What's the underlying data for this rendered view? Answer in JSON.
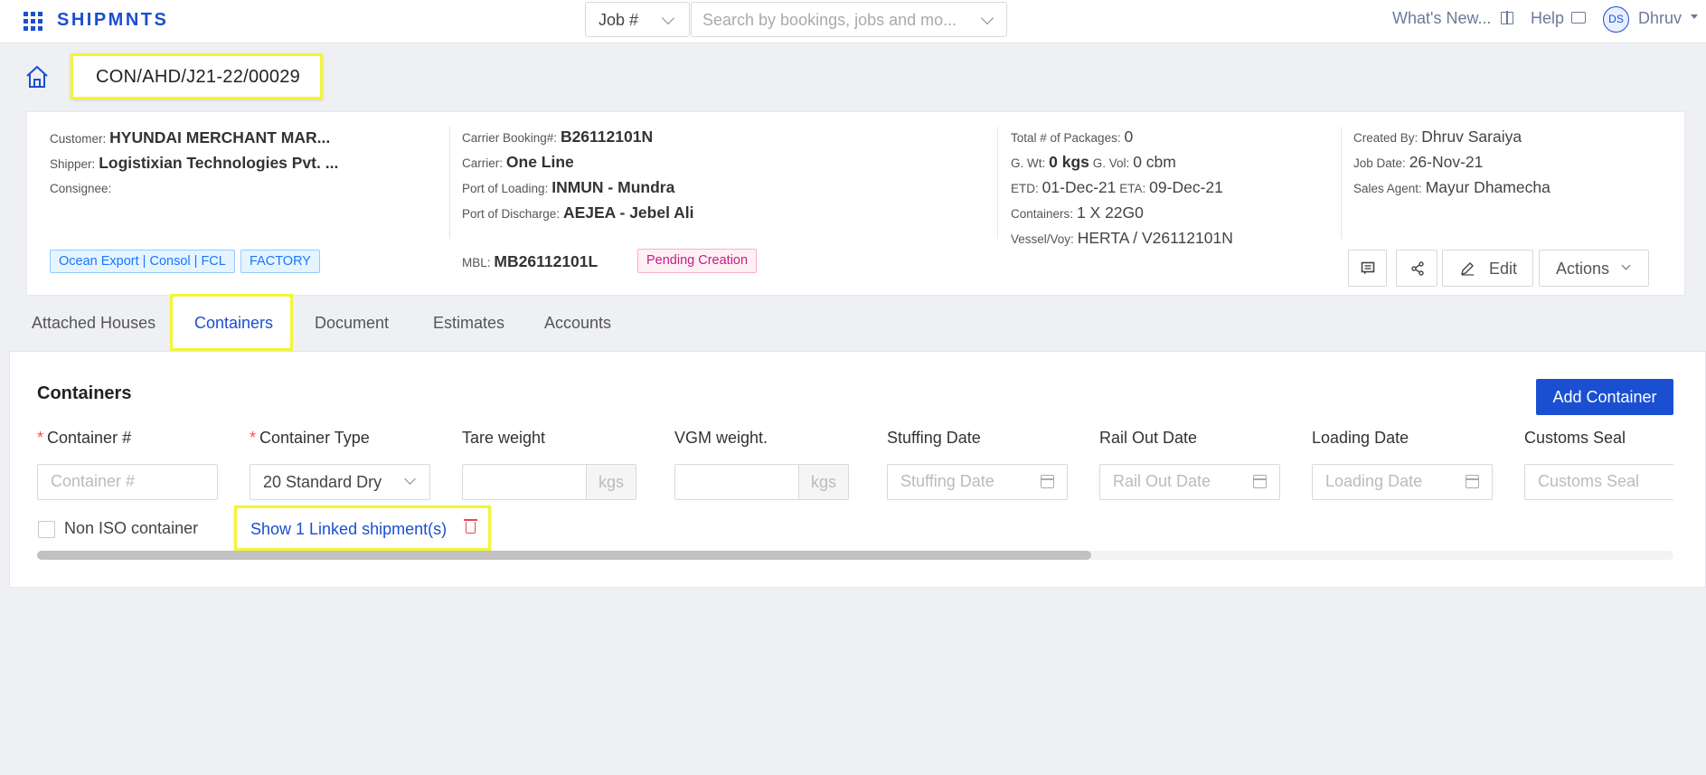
{
  "topbar": {
    "brand": "SHIPMNTS",
    "job_select": "Job #",
    "search_placeholder": "Search by bookings, jobs and mo...",
    "whats_new": "What's New...",
    "help": "Help",
    "avatar_initials": "DS",
    "user_name": "Dhruv"
  },
  "header": {
    "job_id": "CON/AHD/J21-22/00029"
  },
  "summary": {
    "customer_label": "Customer:",
    "customer": "HYUNDAI MERCHANT MAR...",
    "shipper_label": "Shipper:",
    "shipper": "Logistixian Technologies Pvt. ...",
    "consignee_label": "Consignee:",
    "tags": [
      "Ocean Export | Consol | FCL",
      "FACTORY"
    ],
    "carrier_booking_label": "Carrier Booking#:",
    "carrier_booking": "B26112101N",
    "carrier_label": "Carrier:",
    "carrier": "One Line",
    "pol_label": "Port of Loading:",
    "pol": "INMUN - Mundra",
    "pod_label": "Port of Discharge:",
    "pod": "AEJEA - Jebel Ali",
    "mbl_label": "MBL:",
    "mbl": "MB26112101L",
    "status": "Pending Creation",
    "packages_label": "Total # of Packages:",
    "packages": "0",
    "gwt_label": "G. Wt:",
    "gwt": "0 kgs",
    "gvol_label": "G. Vol:",
    "gvol": "0 cbm",
    "etd_label": "ETD:",
    "etd": "01-Dec-21",
    "eta_label": "ETA:",
    "eta": "09-Dec-21",
    "containers_label": "Containers:",
    "containers": "1 X 22G0",
    "vessel_label": "Vessel/Voy:",
    "vessel": "HERTA / V26112101N",
    "created_by_label": "Created By:",
    "created_by": "Dhruv Saraiya",
    "job_date_label": "Job Date:",
    "job_date": "26-Nov-21",
    "sales_agent_label": "Sales Agent:",
    "sales_agent": "Mayur Dhamecha",
    "edit_label": "Edit",
    "actions_label": "Actions"
  },
  "tabs": [
    "Attached Houses",
    "Containers",
    "Document",
    "Estimates",
    "Accounts"
  ],
  "containers_panel": {
    "title": "Containers",
    "add_button": "Add Container",
    "fields": {
      "container_no": {
        "label": "Container #",
        "placeholder": "Container #"
      },
      "container_type": {
        "label": "Container Type",
        "value": "20 Standard Dry"
      },
      "tare_weight": {
        "label": "Tare weight",
        "unit": "kgs"
      },
      "vgm_weight": {
        "label": "VGM weight.",
        "unit": "kgs"
      },
      "stuffing_date": {
        "label": "Stuffing Date",
        "placeholder": "Stuffing Date"
      },
      "rail_out_date": {
        "label": "Rail Out Date",
        "placeholder": "Rail Out Date"
      },
      "loading_date": {
        "label": "Loading Date",
        "placeholder": "Loading Date"
      },
      "customs_seal": {
        "label": "Customs Seal",
        "placeholder": "Customs Seal"
      }
    },
    "non_iso_label": "Non ISO container",
    "linked_shipments": "Show 1 Linked shipment(s)"
  }
}
